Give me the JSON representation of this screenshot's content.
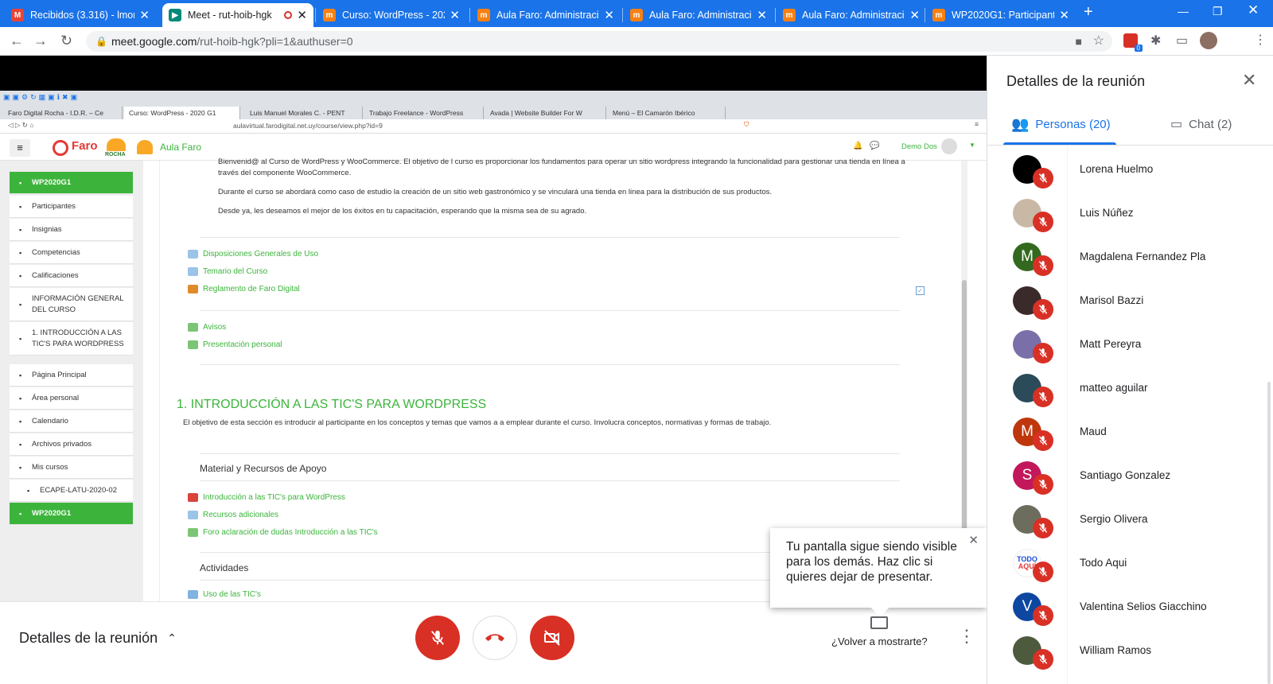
{
  "browser": {
    "tabs": [
      {
        "title": "Recibidos (3.316) - lmora",
        "favicon": "gmail-icon",
        "color": "#ea4335"
      },
      {
        "title": "Meet - rut-hoib-hgk",
        "favicon": "meet-icon",
        "color": "#00897b"
      },
      {
        "title": "Curso: WordPress - 2020",
        "favicon": "moodle-icon",
        "color": "#f98012"
      },
      {
        "title": "Aula Faro: Administració",
        "favicon": "moodle-icon",
        "color": "#f98012"
      },
      {
        "title": "Aula Faro: Administració",
        "favicon": "moodle-icon",
        "color": "#f98012"
      },
      {
        "title": "Aula Faro: Administració",
        "favicon": "moodle-icon",
        "color": "#f98012"
      },
      {
        "title": "WP2020G1: Participantes",
        "favicon": "moodle-icon",
        "color": "#f98012"
      }
    ],
    "url_host": "meet.google.com",
    "url_path": "/rut-hoib-hgk?pli=1&authuser=0",
    "extension_badge": "0"
  },
  "shared_screen": {
    "tabs": [
      "Faro Digital Rocha - I.D.R. – Ce",
      "Curso: WordPress - 2020 G1",
      "Luis Manuel Morales C. - PENT",
      "Trabajo Freelance - WordPress",
      "Avada | Website Builder For W",
      "Menú – El Camarón Ibérico"
    ],
    "url": "aulavirtual.farodigital.net.uy/course/view.php?id=9",
    "site_name": "Aula Faro",
    "logos": [
      "Faro",
      "ROCHA"
    ],
    "user": "Demo Dos",
    "sidebar": [
      {
        "label": "WP2020G1",
        "icon": "graduation-cap-icon",
        "active": true
      },
      {
        "label": "Participantes",
        "icon": "users-icon"
      },
      {
        "label": "Insignias",
        "icon": "shield-icon"
      },
      {
        "label": "Competencias",
        "icon": "check-square-icon"
      },
      {
        "label": "Calificaciones",
        "icon": "table-icon"
      },
      {
        "label": "INFORMACIÓN GENERAL DEL CURSO",
        "icon": "folder-icon"
      },
      {
        "label": "1. INTRODUCCIÓN A LAS TIC'S PARA WORDPRESS",
        "icon": "folder-icon"
      }
    ],
    "sidebar2": [
      {
        "label": "Página Principal",
        "icon": "home-icon"
      },
      {
        "label": "Área personal",
        "icon": "dashboard-icon"
      },
      {
        "label": "Calendario",
        "icon": "calendar-icon"
      },
      {
        "label": "Archivos privados",
        "icon": "file-icon"
      },
      {
        "label": "Mis cursos",
        "icon": "graduation-cap-icon"
      },
      {
        "label": "ECAPE-LATU-2020-02",
        "icon": "graduation-cap-icon"
      },
      {
        "label": "WP2020G1",
        "icon": "graduation-cap-icon",
        "active": true
      }
    ],
    "intro_line1": "Bienvenid@ al Curso de WordPress y WooCommerce. El objetivo de l curso es proporcionar los fundamentos para operar un sitio wordpress integrando la funcionalidad para gestionar una tienda en línea a",
    "intro_line2": "través del componente WooCommerce.",
    "intro_p2": "Durante el curso se abordará como caso de estudio la creación de un sitio web gastronómico y se vinculará una tienda en linea para la distribución de sus productos.",
    "intro_p3": "Desde ya, les deseamos el mejor de los éxitos en tu capacitación, esperando que la misma sea de su agrado.",
    "resources1": [
      "Disposiciones Generales de Uso",
      "Temario del Curso",
      "Reglamento de Faro Digital"
    ],
    "resources2": [
      "Avisos",
      "Presentación personal"
    ],
    "section_title": "1. INTRODUCCIÓN A LAS TIC'S PARA WORDPRESS",
    "section_desc": "El objetivo de esta sección es introducir al participante en los conceptos y temas que vamos a a emplear durante el curso. Involucra conceptos, normativas y formas de trabajo.",
    "sub1": "Material y Recursos de Apoyo",
    "resources3": [
      "Introducción a las TIC's para WordPress",
      "Recursos adicionales",
      "Foro aclaración de dudas Introducción a las TIC's"
    ],
    "sub2": "Actividades",
    "resource4": "Uso de las TIC's"
  },
  "meeting": {
    "details_label": "Detalles de la reunión",
    "present_again": "¿Volver a mostrarte?",
    "toast": "Tu pantalla sigue siendo visible para los demás. Haz clic si quieres dejar de presentar."
  },
  "panel": {
    "title": "Detalles de la reunión",
    "tab_people": "Personas (20)",
    "tab_chat": "Chat (2)",
    "people": [
      {
        "name": "Lorena Huelmo",
        "initial": "",
        "color": "#000000"
      },
      {
        "name": "Luis Núñez",
        "initial": "",
        "color": "#c9b8a6"
      },
      {
        "name": "Magdalena Fernandez Pla",
        "initial": "M",
        "color": "#33691e"
      },
      {
        "name": "Marisol Bazzi",
        "initial": "",
        "color": "#3a2a2a"
      },
      {
        "name": "Matt Pereyra",
        "initial": "",
        "color": "#7a6fa8"
      },
      {
        "name": "matteo aguilar",
        "initial": "",
        "color": "#2b4a5a"
      },
      {
        "name": "Maud",
        "initial": "M",
        "color": "#bf360c"
      },
      {
        "name": "Santiago Gonzalez",
        "initial": "S",
        "color": "#c2185b"
      },
      {
        "name": "Sergio Olivera",
        "initial": "",
        "color": "#6d6d5e"
      },
      {
        "name": "Todo Aqui",
        "initial": "",
        "color": "#ffffff"
      },
      {
        "name": "Valentina Selios Giacchino",
        "initial": "V",
        "color": "#0d47a1"
      },
      {
        "name": "William Ramos",
        "initial": "",
        "color": "#4e5a3e"
      }
    ]
  }
}
